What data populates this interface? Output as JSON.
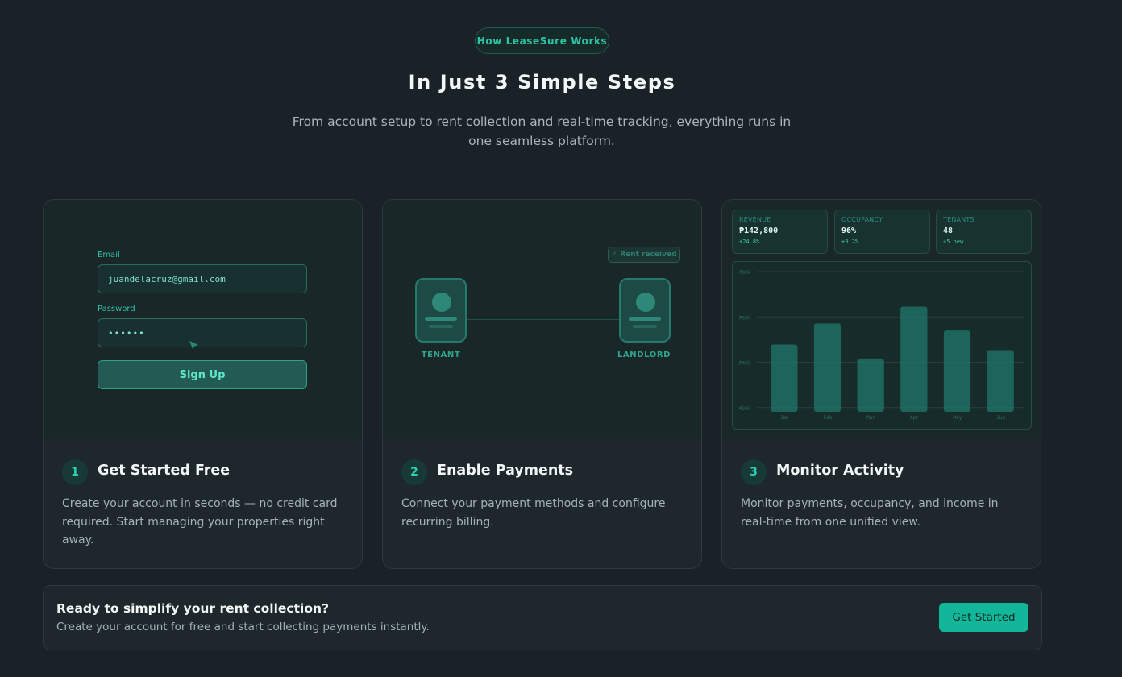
{
  "section": {
    "eyebrow": "How LeaseSure Works",
    "title": "In Just 3 Simple Steps",
    "subtitle": "From account setup to rent collection and real-time tracking, everything runs in one seamless platform."
  },
  "steps": [
    {
      "number": "1",
      "title": "Get Started Free",
      "description": "Create your account in seconds — no credit card required. Start managing your properties right away.",
      "form": {
        "email_label": "Email",
        "email_value": "juandelacruz@gmail.com",
        "password_label": "Password",
        "password_value": "••••••",
        "button_label": "Sign Up"
      }
    },
    {
      "number": "2",
      "title": "Enable Payments",
      "description": "Connect your payment methods and configure recurring billing.",
      "flow": {
        "badge": "✓ Rent received",
        "left_label": "TENANT",
        "right_label": "LANDLORD"
      }
    },
    {
      "number": "3",
      "title": "Monitor Activity",
      "description": "Monitor payments, occupancy, and income in real-time from one unified view.",
      "kpis": [
        {
          "label": "REVENUE",
          "value": "₱142,800",
          "delta": "+24.8%"
        },
        {
          "label": "OCCUPANCY",
          "value": "96%",
          "delta": "+3.2%"
        },
        {
          "label": "TENANTS",
          "value": "48",
          "delta": "+5 new"
        }
      ]
    }
  ],
  "chart_data": {
    "type": "bar",
    "categories": [
      "Jan",
      "Feb",
      "Mar",
      "Apr",
      "May",
      "Jun"
    ],
    "values": [
      48,
      63,
      38,
      75,
      58,
      44
    ],
    "ytick_labels": [
      "₱80k",
      "₱60k",
      "₱40k",
      "₱20k"
    ],
    "ylim": [
      0,
      100
    ],
    "grid": true,
    "bar_color": "#1f7a6b"
  },
  "cta": {
    "title": "Ready to simplify your rent collection?",
    "subtitle": "Create your account for free and start collecting payments instantly.",
    "button_label": "Get Started"
  },
  "colors": {
    "accent": "#12b79a",
    "background": "#1b2227"
  }
}
